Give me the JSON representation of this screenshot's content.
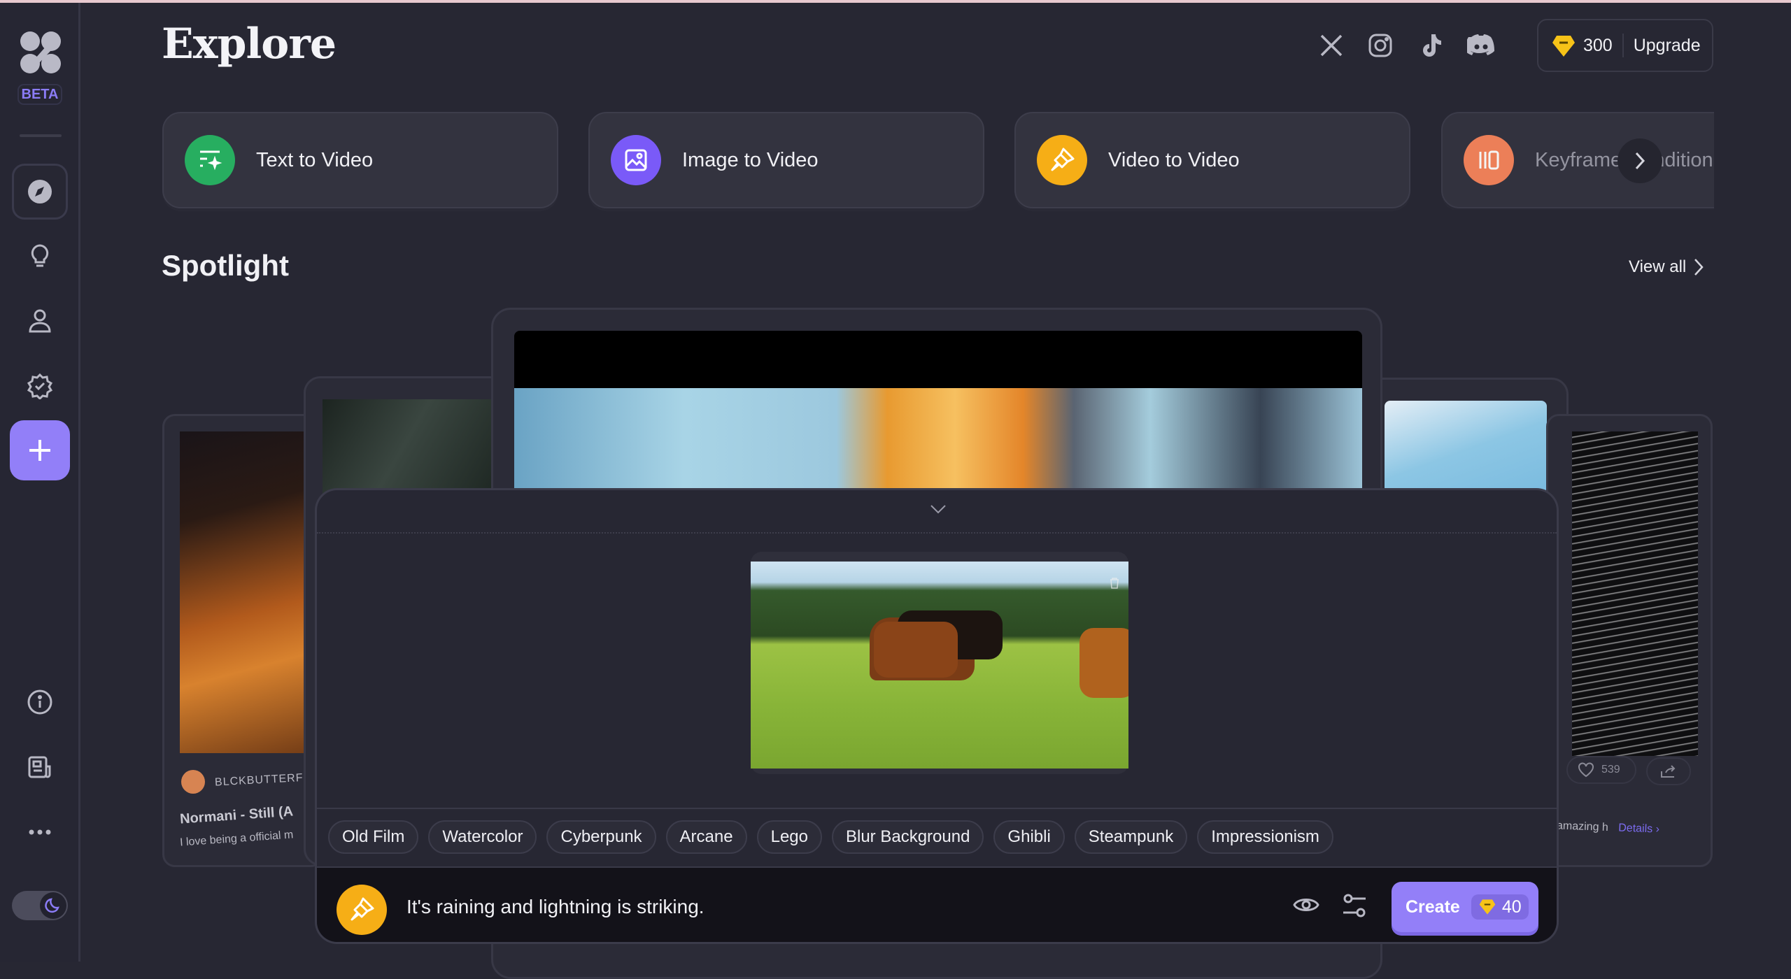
{
  "app": {
    "badge": "BETA",
    "page_title": "Explore"
  },
  "sidebar": {
    "items": [
      {
        "name": "explore",
        "icon": "compass-icon",
        "active": true
      },
      {
        "name": "ideas",
        "icon": "lightbulb-icon"
      },
      {
        "name": "profile",
        "icon": "user-icon"
      },
      {
        "name": "verified",
        "icon": "badge-check-icon"
      },
      {
        "name": "create",
        "icon": "plus-icon"
      }
    ],
    "bottom": [
      {
        "name": "info",
        "icon": "info-icon"
      },
      {
        "name": "news",
        "icon": "newspaper-icon"
      },
      {
        "name": "more",
        "icon": "more-horizontal-icon"
      }
    ],
    "theme_toggle": {
      "mode": "dark",
      "icon": "moon-icon"
    }
  },
  "header": {
    "socials": [
      "X",
      "Instagram",
      "TikTok",
      "Discord"
    ],
    "credits": "300",
    "upgrade_label": "Upgrade"
  },
  "modes": [
    {
      "label": "Text to Video",
      "color": "#27ae60",
      "icon": "text-sparkle-icon"
    },
    {
      "label": "Image to Video",
      "color": "#7a5af8",
      "icon": "image-icon"
    },
    {
      "label": "Video to Video",
      "color": "#f6ae16",
      "icon": "brush-icon"
    },
    {
      "label": "Keyframe Conditioning",
      "color": "#f7845a",
      "icon": "keyframe-icon"
    }
  ],
  "spotlight": {
    "title": "Spotlight",
    "view_all": "View all",
    "left_card": {
      "author": "BLCKBUTTERFL",
      "title": "Normani - Still (A",
      "desc": "I love being a official m"
    },
    "right_card": {
      "likes": "539",
      "desc": "amazing h",
      "details": "Details"
    }
  },
  "composer": {
    "styles": [
      "Old Film",
      "Watercolor",
      "Cyberpunk",
      "Arcane",
      "Lego",
      "Blur Background",
      "Ghibli",
      "Steampunk",
      "Impressionism"
    ],
    "prompt": "It's raining and lightning is striking.",
    "create_label": "Create",
    "cost": "40"
  }
}
